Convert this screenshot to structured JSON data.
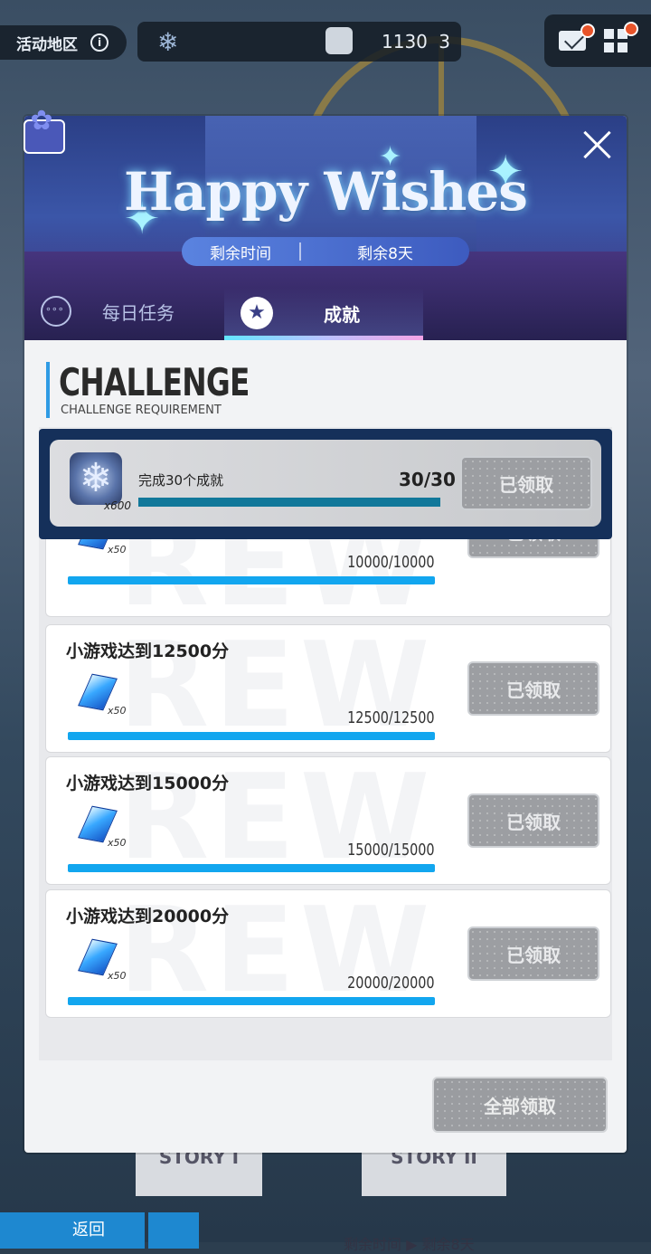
{
  "hud": {
    "region_label": "活动地区",
    "info_icon": "i",
    "snowflake_count": "1130",
    "glove_count": "3"
  },
  "banner": {
    "title": "Happy Wishes",
    "time_label": "剩余时间",
    "time_value": "剩余8天"
  },
  "tabs": [
    {
      "label": "每日任务",
      "active": false
    },
    {
      "label": "成就",
      "active": true
    }
  ],
  "section": {
    "title": "CHALLENGE",
    "subtitle": "CHALLENGE REQUIREMENT"
  },
  "highlight_task": {
    "name": "完成30个成就",
    "reward_qty": "x600",
    "progress": "30/30",
    "button": "已领取"
  },
  "tasks": [
    {
      "name": "",
      "reward_qty": "x50",
      "progress": "10000/10000",
      "button": "已领取"
    },
    {
      "name": "小游戏达到12500分",
      "reward_qty": "x50",
      "progress": "12500/12500",
      "button": "已领取"
    },
    {
      "name": "小游戏达到15000分",
      "reward_qty": "x50",
      "progress": "15000/15000",
      "button": "已领取"
    },
    {
      "name": "小游戏达到20000分",
      "reward_qty": "x50",
      "progress": "20000/20000",
      "button": "已领取"
    }
  ],
  "claim_all": "全部领取",
  "background": {
    "story1": "STORY I",
    "story2": "STORY II",
    "back": "返回",
    "bottom_time": "剩余时间 ▶ 剩余8天"
  },
  "colors": {
    "accent_blue": "#12a6ef",
    "banner_purple": "#3b56a8",
    "claimed_gray": "#9c9ea2"
  }
}
